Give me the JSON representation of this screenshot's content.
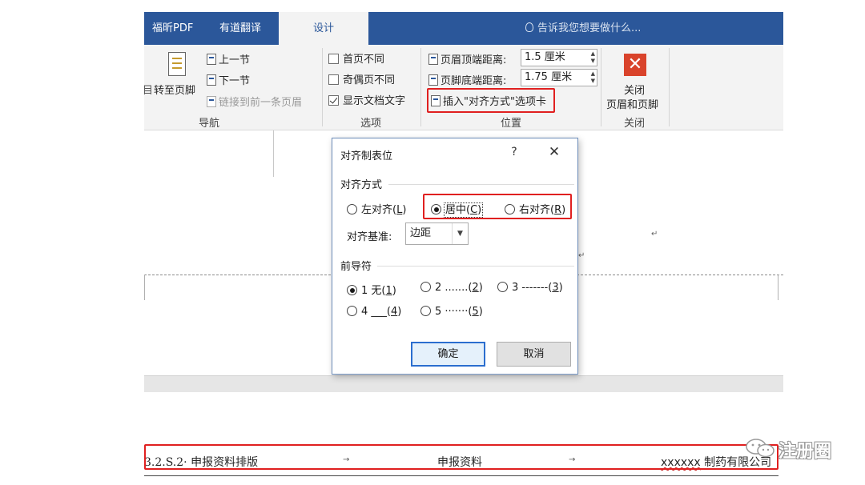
{
  "ribbon": {
    "tabs": [
      "福昕PDF",
      "有道翻译",
      "设计"
    ],
    "active_tab": "设计",
    "tell_me": "告诉我您想要做什么...",
    "navigation": {
      "goto_footer": "转至页脚",
      "prev_section": "上一节",
      "next_section": "下一节",
      "link_previous": "链接到前一条页眉",
      "label": "导航",
      "left_cut_char": "目"
    },
    "options": {
      "first_page_diff": "首页不同",
      "odd_even_diff": "奇偶页不同",
      "show_doc_text": "显示文档文字",
      "show_doc_text_checked": true,
      "label": "选项"
    },
    "position": {
      "header_top_label": "页眉顶端距离:",
      "header_top_value": "1.5 厘米",
      "footer_bottom_label": "页脚底端距离:",
      "footer_bottom_value": "1.75 厘米",
      "insert_align_tab": "插入\"对齐方式\"选项卡",
      "label": "位置"
    },
    "close": {
      "line1": "关闭",
      "line2": "页眉和页脚",
      "label": "关闭"
    }
  },
  "dialog": {
    "title": "对齐制表位",
    "help": "?",
    "close": "✕",
    "alignment": {
      "label": "对齐方式",
      "options": [
        {
          "text": "左对齐(",
          "key": "L",
          "checked": false
        },
        {
          "text": "居中(",
          "key": "C",
          "checked": true
        },
        {
          "text": "右对齐(",
          "key": "R",
          "checked": false
        }
      ]
    },
    "base": {
      "label": "对齐基准:",
      "value": "边距"
    },
    "leader": {
      "label": "前导符",
      "options": [
        {
          "text": "1 无(",
          "key": "1",
          "checked": true
        },
        {
          "text": "2 .......(",
          "key": "2",
          "checked": false
        },
        {
          "text": "3 -------(",
          "key": "3",
          "checked": false
        },
        {
          "text": "4 ___(",
          "key": "4",
          "checked": false
        },
        {
          "text": "5 ·······(",
          "key": "5",
          "checked": false
        }
      ]
    },
    "ok": "确定",
    "cancel": "取消"
  },
  "document": {
    "header_left": "3.2.S.2· 申报资料排版",
    "header_center": "申报资料",
    "header_right_misspelled": "xxxxxx",
    "header_right": " 制药有限公司",
    "tab_arrow": "→",
    "return_mark": "↵"
  },
  "watermark": {
    "text": "注册圈"
  },
  "colors": {
    "ribbon_blue": "#2b579a",
    "highlight_red": "#e02020",
    "close_red": "#d9432b"
  }
}
